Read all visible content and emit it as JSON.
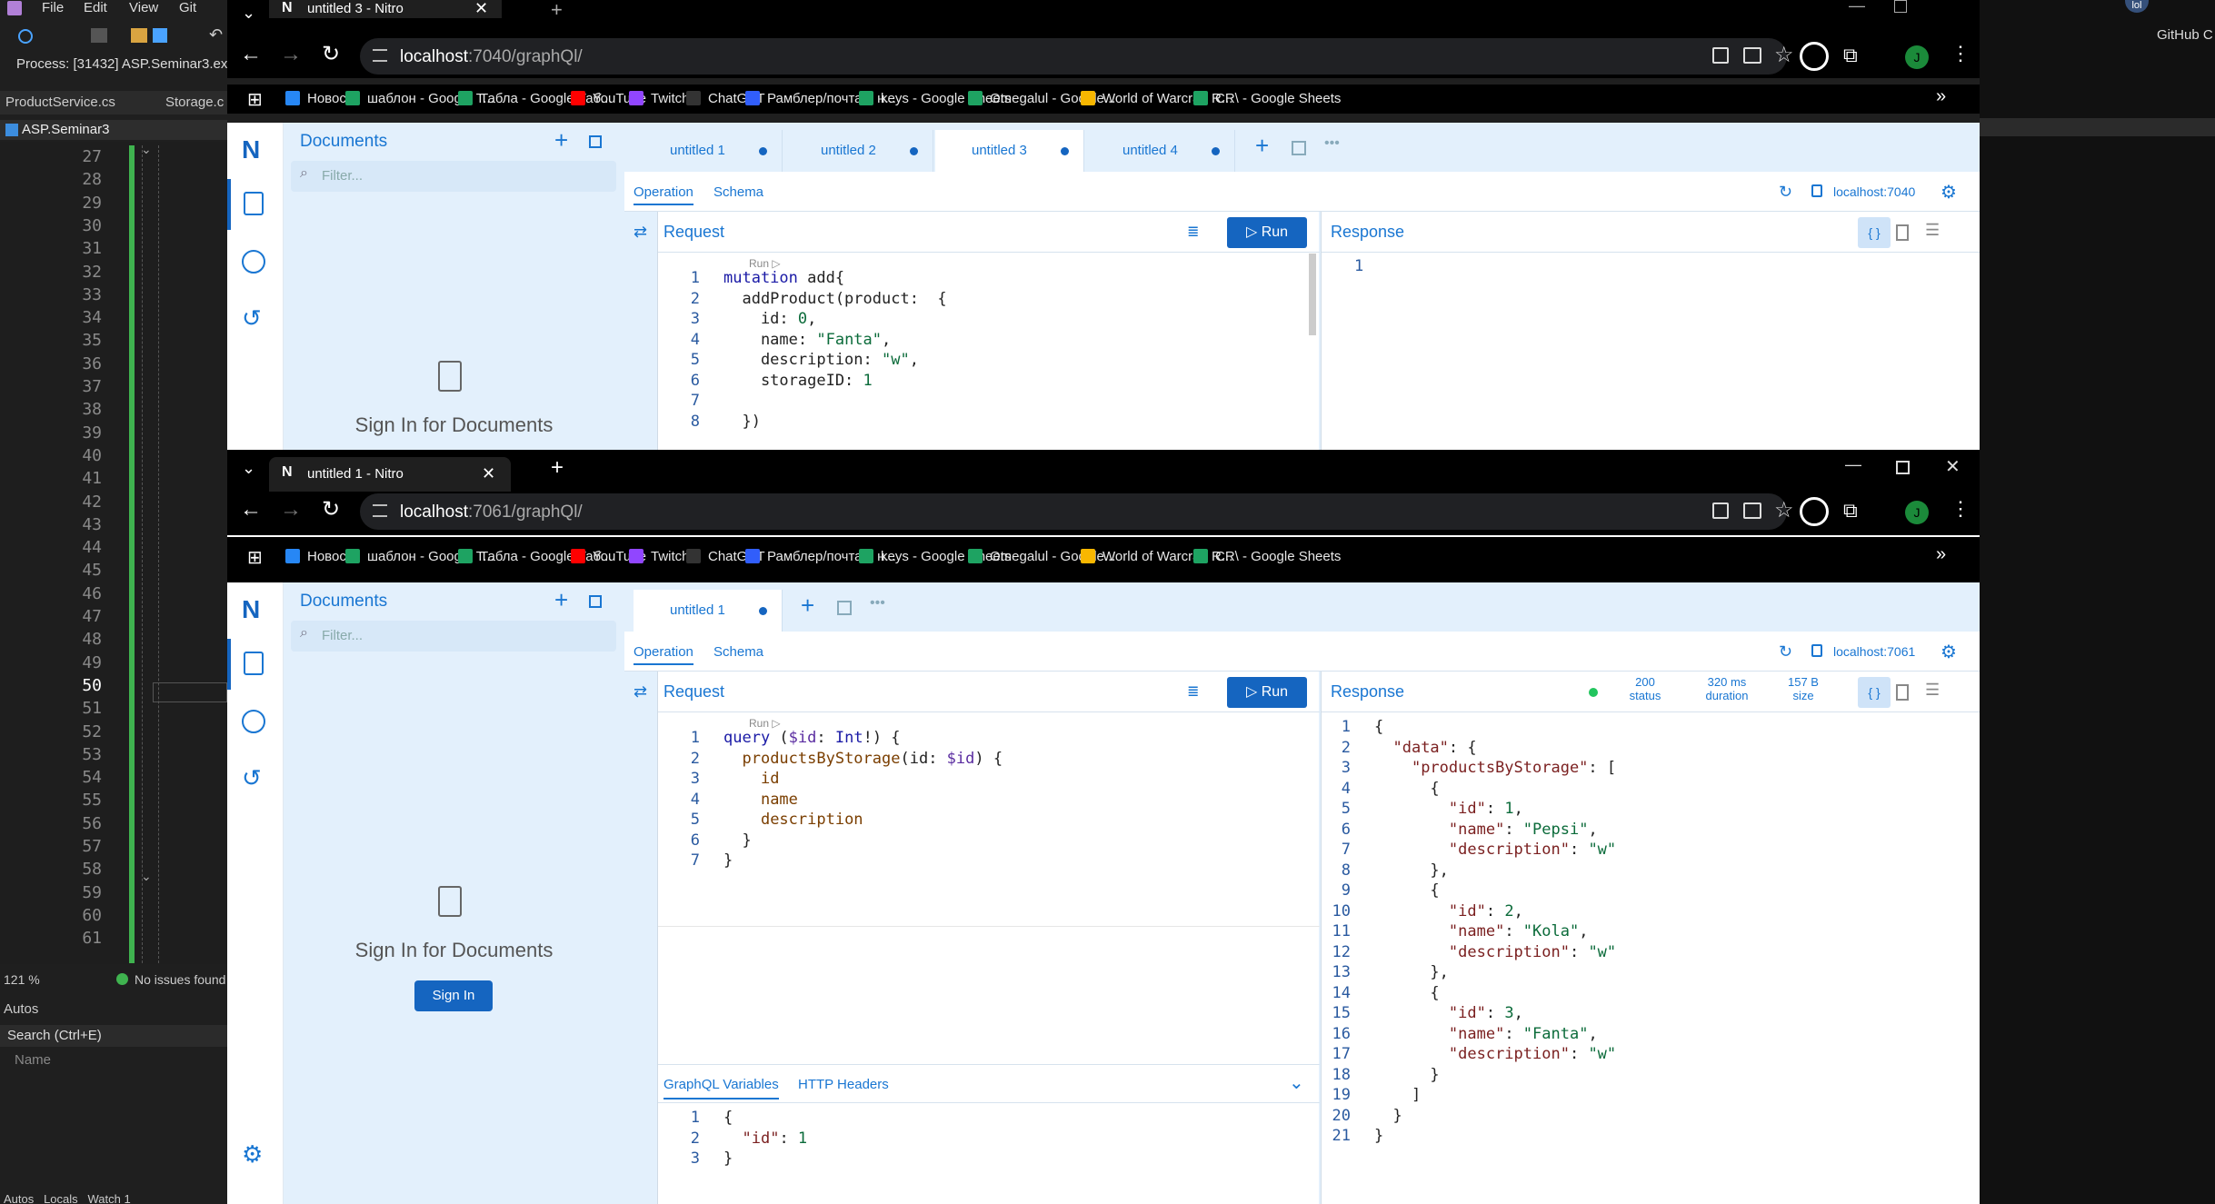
{
  "vs": {
    "menu": [
      "File",
      "Edit",
      "View",
      "Git"
    ],
    "process": "Process:  [31432] ASP.Seminar3.ex",
    "tabs": [
      "ProductService.cs",
      "Storage.c"
    ],
    "project": "ASP.Seminar3",
    "line_numbers": [
      "27",
      "28",
      "29",
      "30",
      "31",
      "32",
      "33",
      "34",
      "35",
      "36",
      "37",
      "38",
      "39",
      "40",
      "41",
      "42",
      "43",
      "44",
      "45",
      "46",
      "47",
      "48",
      "49",
      "50",
      "51",
      "52",
      "53",
      "54",
      "55",
      "56",
      "57",
      "58",
      "59",
      "60",
      "61"
    ],
    "zoom": "121 %",
    "status": "No issues found",
    "autos_title": "Autos",
    "search_placeholder": "Search (Ctrl+E)",
    "name_col": "Name",
    "bottom_tabs": "Autos   Locals   Watch 1",
    "right_label": "GitHub C",
    "avatar_label": "lol"
  },
  "bookmarks": [
    {
      "label": "Новости",
      "color": "#2787f5"
    },
    {
      "label": "шаблон - Google Т...",
      "color": "#1ea362"
    },
    {
      "label": "Табла - Google Таб...",
      "color": "#1ea362"
    },
    {
      "label": "YouTube",
      "color": "#ff0000"
    },
    {
      "label": "Twitch",
      "color": "#9146ff"
    },
    {
      "label": "ChatGPT",
      "color": "#333333"
    },
    {
      "label": "Рамблер/почта – н...",
      "color": "#315efb"
    },
    {
      "label": "keys - Google Sheets",
      "color": "#1ea362"
    },
    {
      "label": "Omegalul - Google...",
      "color": "#1ea362"
    },
    {
      "label": "World of Warcraft R...",
      "color": "#f8b700"
    },
    {
      "label": "CR\\ - Google Sheets",
      "color": "#1ea362"
    }
  ],
  "win1": {
    "tab_title": "untitled 3 - Nitro",
    "url_host": "localhost",
    "url_rest": ":7040/graphQl/",
    "docs_title": "Documents",
    "filter_placeholder": "Filter...",
    "signin_text": "Sign In for Documents",
    "doc_tabs": [
      "untitled 1",
      "untitled 2",
      "untitled 3",
      "untitled 4"
    ],
    "subtabs": [
      "Operation",
      "Schema"
    ],
    "endpoint": "localhost:7040",
    "request_label": "Request",
    "run_label": "Run",
    "response_label": "Response",
    "run_hint": "Run ▷",
    "response_line": "1",
    "query_lines": [
      [
        "mutation",
        " add{"
      ],
      [
        "  addProduct(product:  {"
      ],
      [
        "    id: 0,"
      ],
      [
        "    name: \"Fanta\","
      ],
      [
        "    description: \"w\","
      ],
      [
        "    storageID: 1"
      ],
      [
        ""
      ],
      [
        "  })"
      ]
    ]
  },
  "win2": {
    "tab_title": "untitled 1 - Nitro",
    "url_host": "localhost",
    "url_rest": ":7061/graphQl/",
    "docs_title": "Documents",
    "filter_placeholder": "Filter...",
    "signin_text": "Sign In for Documents",
    "signin_button": "Sign In",
    "doc_tabs": [
      "untitled 1"
    ],
    "subtabs": [
      "Operation",
      "Schema"
    ],
    "endpoint": "localhost:7061",
    "request_label": "Request",
    "run_label": "Run",
    "response_label": "Response",
    "run_hint": "Run ▷",
    "status_value": "200",
    "status_label": "status",
    "duration_value": "320 ms",
    "duration_label": "duration",
    "size_value": "157 B",
    "size_label": "size",
    "var_tabs": [
      "GraphQL Variables",
      "HTTP Headers"
    ],
    "variables": [
      "{",
      "  \"id\": 1",
      "}"
    ],
    "query": [
      "query ($id: Int!) {",
      "  productsByStorage(id: $id) {",
      "    id",
      "    name",
      "    description",
      "  }",
      "}"
    ],
    "response": [
      "{",
      "  \"data\": {",
      "    \"productsByStorage\": [",
      "      {",
      "        \"id\": 1,",
      "        \"name\": \"Pepsi\",",
      "        \"description\": \"w\"",
      "      },",
      "      {",
      "        \"id\": 2,",
      "        \"name\": \"Kola\",",
      "        \"description\": \"w\"",
      "      },",
      "      {",
      "        \"id\": 3,",
      "        \"name\": \"Fanta\",",
      "        \"description\": \"w\"",
      "      }",
      "    ]",
      "  }",
      "}"
    ]
  },
  "colors": {
    "accent": "#1976d2",
    "run": "#1565c0",
    "docs_bg": "#e3f0fc",
    "ok": "#22c55e"
  }
}
